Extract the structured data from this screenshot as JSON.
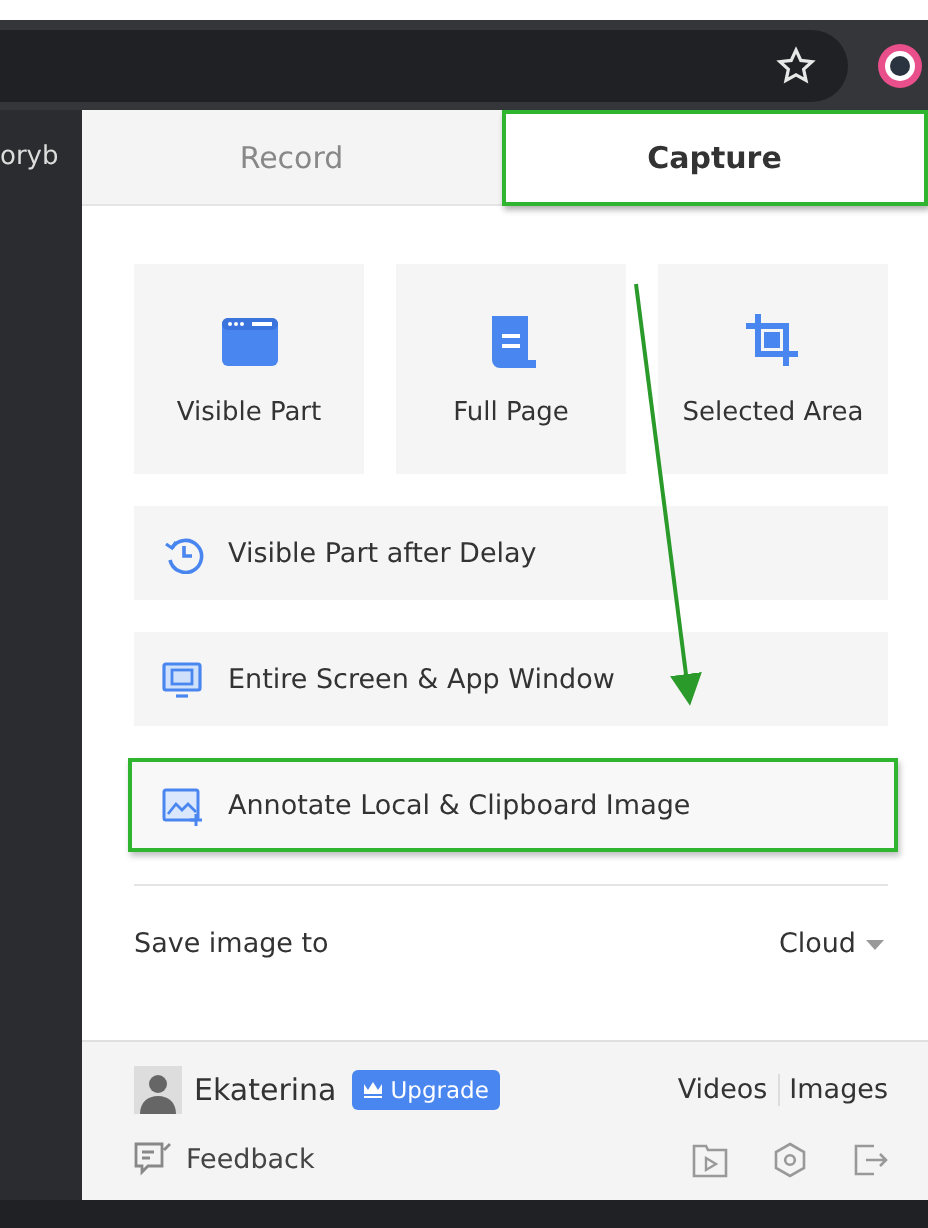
{
  "browser": {
    "side_text": "oryb"
  },
  "tabs": [
    {
      "label": "Record",
      "selected": false,
      "highlighted": false
    },
    {
      "label": "Capture",
      "selected": true,
      "highlighted": true
    }
  ],
  "tiles": [
    {
      "kind": "window",
      "label": "Visible Part"
    },
    {
      "kind": "scroll",
      "label": "Full Page"
    },
    {
      "kind": "crop",
      "label": "Selected Area"
    }
  ],
  "options": [
    {
      "kind": "delay",
      "label": "Visible Part after Delay",
      "highlighted": false
    },
    {
      "kind": "screen",
      "label": "Entire Screen & App Window",
      "highlighted": false
    },
    {
      "kind": "image",
      "label": "Annotate Local & Clipboard Image",
      "highlighted": true
    }
  ],
  "save": {
    "label": "Save image to",
    "value": "Cloud"
  },
  "footer": {
    "user": "Ekaterina",
    "upgrade": "Upgrade",
    "links": [
      "Videos",
      "Images"
    ],
    "feedback": "Feedback"
  }
}
